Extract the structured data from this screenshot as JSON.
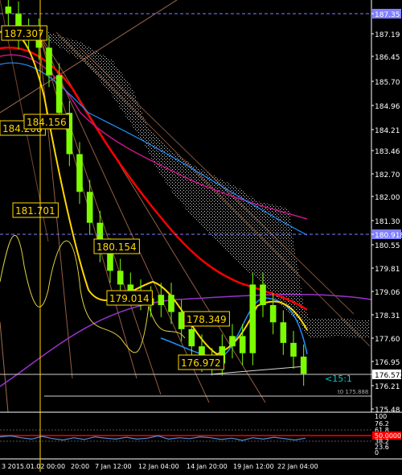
{
  "colors": {
    "background": "#000000",
    "axis_text": "#ffffff",
    "candle": "#7CFC00",
    "fast_ma": "#FFD700",
    "slow_ma": "#FF0000",
    "blue_line": "#1E90FF",
    "purple_line": "#9932CC",
    "orange_line": "#D2691E",
    "cloud": "#FFFFFF",
    "label_box_fill": "#000000",
    "label_box_border": "#FFD700",
    "label_text": "#FFD700",
    "h_line": "#8080FF",
    "price_highlight_purple": "#8080FF",
    "info_text": "#00CED1"
  },
  "chart_data": {
    "type": "candlestick",
    "title": "",
    "y_axis_labels": [
      "187.35",
      "187.19",
      "186.45",
      "185.70",
      "184.96",
      "184.21",
      "183.46",
      "182.70",
      "182.00",
      "181.30",
      "180.918",
      "180.55",
      "179.81",
      "179.06",
      "178.31",
      "177.60",
      "176.95",
      "176.572",
      "176.21",
      "175.48"
    ],
    "highlighted_prices": [
      "187.35",
      "180.918",
      "176.572"
    ],
    "x_axis_labels": [
      "3 2015.01.02 00:00",
      "20:00",
      "7 Jan 12:00",
      "12 Jan 04:00",
      "14 Jan 20:00",
      "19 Jan 12:00",
      "22 Jan 04:00"
    ],
    "price_labels": [
      "187.307",
      "184.208",
      "184.156",
      "181.701",
      "180.154",
      "179.014",
      "178.349",
      "176.972"
    ],
    "right_annotation": "<15:1",
    "small_annotation": "t0 175.888",
    "indicator_axis_labels": [
      "100",
      "76.2",
      "61.8",
      "50.0000",
      "38.2",
      "23.6",
      "0"
    ],
    "indicator_level": "50.0000",
    "ylim": [
      175.48,
      187.35
    ],
    "close_series": [
      187.1,
      186.4,
      186.6,
      186.1,
      185.3,
      184.2,
      183.0,
      181.9,
      181.0,
      180.2,
      179.6,
      179.2,
      179.0,
      178.8,
      178.6,
      178.9,
      178.4,
      177.9,
      177.4,
      177.0,
      176.9,
      177.4,
      177.7,
      177.2,
      179.2,
      178.6,
      178.1,
      177.5,
      177.1,
      176.6
    ]
  },
  "indicator_data": {
    "type": "line",
    "values": [
      49,
      51,
      47,
      44,
      50,
      45,
      42,
      47,
      43,
      49,
      46,
      44,
      48,
      44,
      46,
      51,
      44,
      47,
      45,
      49,
      47,
      43,
      46,
      41,
      47,
      44,
      48,
      45,
      42,
      46
    ]
  }
}
